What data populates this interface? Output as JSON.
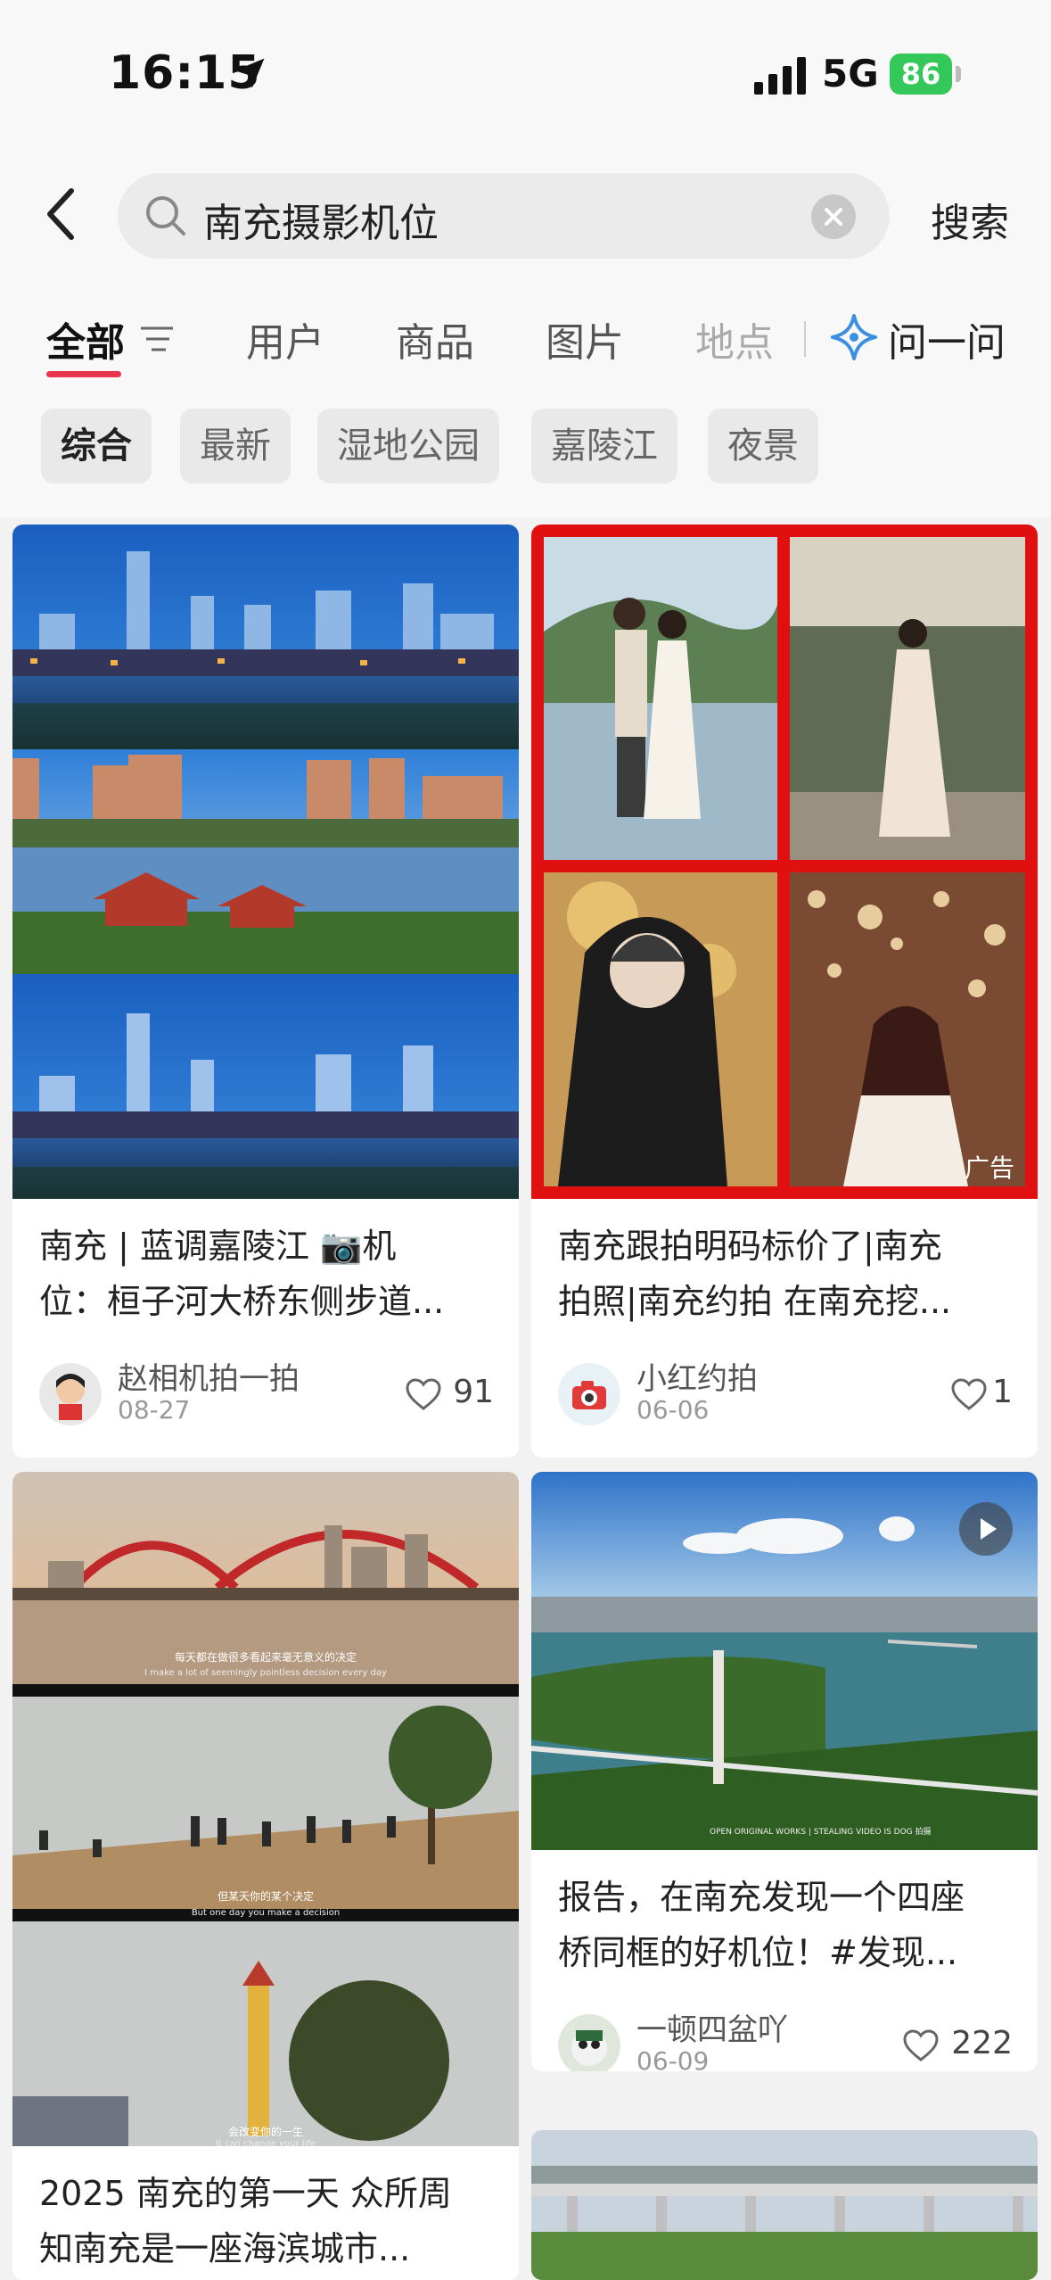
{
  "status": {
    "time": "16:15",
    "network": "5G",
    "battery": "86"
  },
  "search": {
    "query": "南充摄影机位",
    "button": "搜索"
  },
  "tabs": {
    "all": "全部",
    "users": "用户",
    "products": "商品",
    "images": "图片",
    "places": "地点",
    "ask": "问一问"
  },
  "chips": [
    "综合",
    "最新",
    "湿地公园",
    "嘉陵江",
    "夜景"
  ],
  "cards": [
    {
      "title_line1": "南充 | 蓝调嘉陵江 📷机",
      "title_line2": "位：桓子河大桥东侧步道...",
      "author": "赵相机拍一拍",
      "date": "08-27",
      "likes": "91"
    },
    {
      "title_line1": "南充跟拍明码标价了|南充",
      "title_line2": "拍照|南充约拍 在南充挖...",
      "author": "小红约拍",
      "date": "06-06",
      "likes": "1",
      "ad": "广告"
    },
    {
      "title_line1": "2025 南充的第一天 众所周",
      "title_line2": "知南充是一座海滨城市..."
    },
    {
      "title_line1": "报告，在南充发现一个四座",
      "title_line2": "桥同框的好机位！#发现...",
      "author": "一顿四盆吖",
      "date": "06-09",
      "likes": "222"
    }
  ],
  "image_captions": {
    "c3a_cn": "每天都在做很多看起来毫无意义的决定",
    "c3a_en": "I make a lot of seemingly pointless decision every day",
    "c3b_cn": "但某天你的某个决定",
    "c3b_en": "But one day you make a decision",
    "c3c_cn": "会改变你的一生",
    "c3c_en": "It can change your life",
    "c4_wm": "OPEN ORIGINAL WORKS | STEALING VIDEO IS DOG 拍摄"
  },
  "colors": {
    "accent": "#e8344e",
    "ad_border": "#e01010",
    "battery": "#34c759"
  }
}
